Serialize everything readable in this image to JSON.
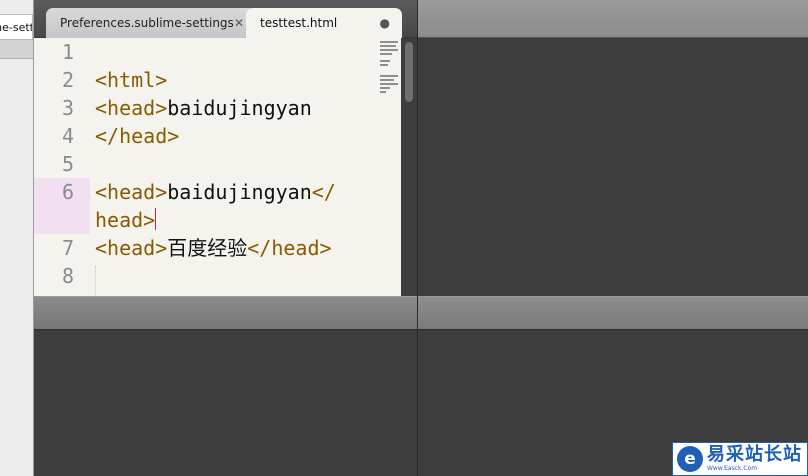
{
  "left_pane": {
    "partial_tab_label": "me-sett"
  },
  "tabs": [
    {
      "label": "Preferences.sublime-settings",
      "control": "✕",
      "active": false
    },
    {
      "label": "testtest.html",
      "control": "●",
      "active": true
    }
  ],
  "gutter": [
    "1",
    "2",
    "3",
    "",
    "4",
    "5",
    "6",
    "7",
    "8"
  ],
  "code": {
    "line2_tag": "<html>",
    "line3_tag": "<head>",
    "line3_text": "baidujingyan",
    "line4_tag": "</head>",
    "line6_tag_open": "<head>",
    "line6_text": "baidujingyan",
    "line6_close_a": "</",
    "line6_close_b": "head>",
    "line7_tag_open": "<head>",
    "line7_text": "百度经验",
    "line7_tag_close": "</head>"
  },
  "logo": {
    "mark": "e",
    "name": "易采站长站",
    "sub": "Www.Easck.Com"
  }
}
